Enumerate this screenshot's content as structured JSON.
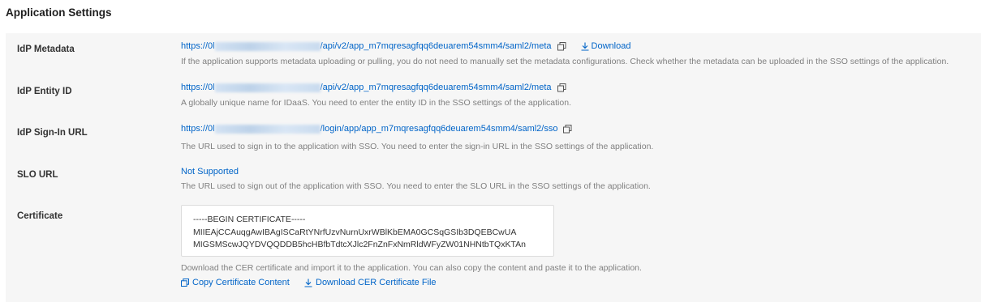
{
  "section_title": "Application Settings",
  "rows": {
    "metadata": {
      "label": "IdP Metadata",
      "url_prefix": "https://0l",
      "url_suffix": "/api/v2/app_m7mqresagfqq6deuarem54smm4/saml2/meta",
      "download_label": "Download",
      "description": "If the application supports metadata uploading or pulling, you do not need to manually set the metadata configurations. Check whether the metadata can be uploaded in the SSO settings of the application."
    },
    "entity_id": {
      "label": "IdP Entity ID",
      "url_prefix": "https://0l",
      "url_suffix": "/api/v2/app_m7mqresagfqq6deuarem54smm4/saml2/meta",
      "description": "A globally unique name for IDaaS. You need to enter the entity ID in the SSO settings of the application."
    },
    "signin_url": {
      "label": "IdP Sign-In URL",
      "url_prefix": "https://0l",
      "url_suffix": "/login/app/app_m7mqresagfqq6deuarem54smm4/saml2/sso",
      "description": "The URL used to sign in to the application with SSO. You need to enter the sign-in URL in the SSO settings of the application."
    },
    "slo_url": {
      "label": "SLO URL",
      "value": "Not Supported",
      "description": "The URL used to sign out of the application with SSO. You need to enter the SLO URL in the SSO settings of the application."
    },
    "certificate": {
      "label": "Certificate",
      "lines": [
        "-----BEGIN CERTIFICATE-----",
        "MIIEAjCCAuqgAwIBAgISCaRtYNrfUzvNurnUxrWBlKbEMA0GCSqGSIb3DQEBCwUA",
        "MIGSMScwJQYDVQQDDB5hcHBfbTdtcXJlc2FnZnFxNmRldWFyZW01NHNtbTQxKTAn"
      ],
      "description": "Download the CER certificate and import it to the application. You can also copy the content and paste it to the application.",
      "copy_label": "Copy Certificate Content",
      "download_label": "Download CER Certificate File"
    }
  },
  "colors": {
    "link": "#0064c8",
    "panel_bg": "#f6f6f6",
    "muted": "#808080"
  },
  "icons": {
    "copy": "copy-icon",
    "download": "download-icon"
  }
}
